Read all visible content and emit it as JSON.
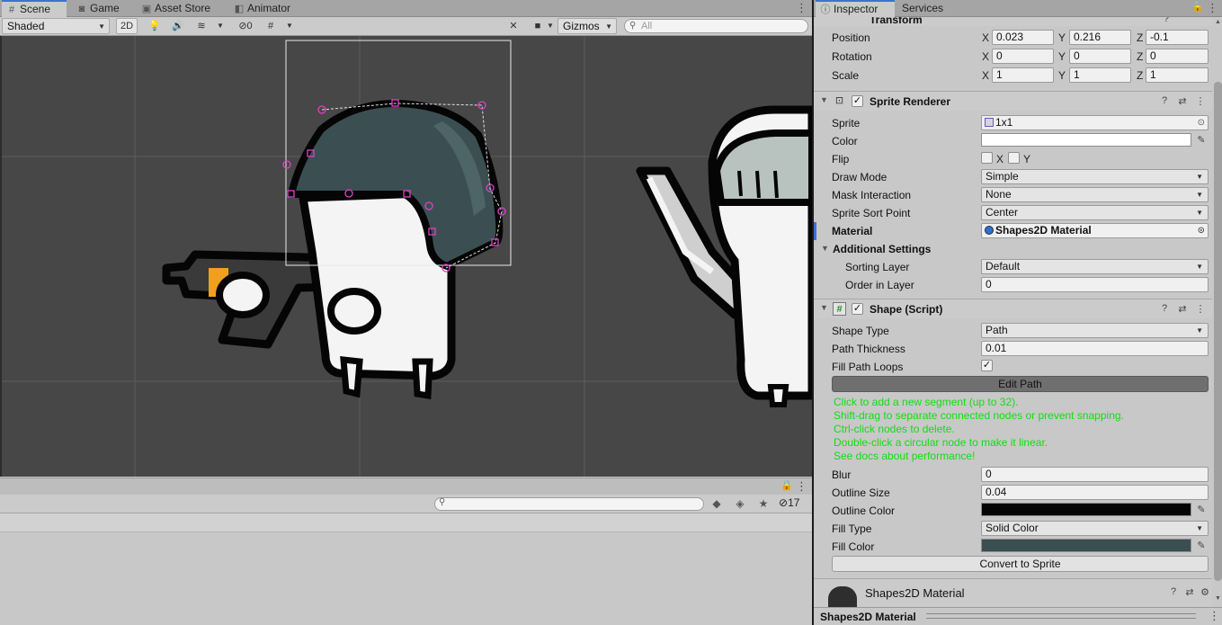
{
  "scene_window": {
    "tabs": [
      {
        "label": "Scene",
        "icon": "grid-icon"
      },
      {
        "label": "Game",
        "icon": "gamepad-icon"
      },
      {
        "label": "Asset Store",
        "icon": "store-icon"
      },
      {
        "label": "Animator",
        "icon": "animator-icon"
      }
    ],
    "toolbar": {
      "draw_mode": "Shaded",
      "mode_2d": "2D",
      "hidden_count": "0",
      "gizmos": "Gizmos",
      "search_placeholder": "All"
    }
  },
  "lower_panel": {
    "hidden_count": "17"
  },
  "inspector": {
    "tabs": [
      {
        "label": "Inspector",
        "icon": "info-icon"
      },
      {
        "label": "Services",
        "icon": ""
      }
    ],
    "transform": {
      "title": "Transform",
      "position": {
        "label": "Position",
        "x": "0.023",
        "y": "0.216",
        "z": "-0.1"
      },
      "rotation": {
        "label": "Rotation",
        "x": "0",
        "y": "0",
        "z": "0"
      },
      "scale": {
        "label": "Scale",
        "x": "1",
        "y": "1",
        "z": "1"
      },
      "axis_x": "X",
      "axis_y": "Y",
      "axis_z": "Z"
    },
    "sprite_renderer": {
      "title": "Sprite Renderer",
      "sprite": {
        "label": "Sprite",
        "value": "1x1"
      },
      "color": {
        "label": "Color",
        "value": "#ffffff"
      },
      "flip": {
        "label": "Flip",
        "x_label": "X",
        "y_label": "Y"
      },
      "draw_mode": {
        "label": "Draw Mode",
        "value": "Simple"
      },
      "mask_interaction": {
        "label": "Mask Interaction",
        "value": "None"
      },
      "sprite_sort_point": {
        "label": "Sprite Sort Point",
        "value": "Center"
      },
      "material": {
        "label": "Material",
        "value": "Shapes2D Material"
      },
      "additional_settings": "Additional Settings",
      "sorting_layer": {
        "label": "Sorting Layer",
        "value": "Default"
      },
      "order_in_layer": {
        "label": "Order in Layer",
        "value": "0"
      }
    },
    "shape_script": {
      "title": "Shape (Script)",
      "shape_type": {
        "label": "Shape Type",
        "value": "Path"
      },
      "path_thickness": {
        "label": "Path Thickness",
        "value": "0.01"
      },
      "fill_path_loops": {
        "label": "Fill Path Loops",
        "checked": true
      },
      "edit_path_button": "Edit Path",
      "help_lines": [
        "Click to add a new segment (up to 32).",
        "Shift-drag to separate connected nodes or prevent snapping.",
        "Ctrl-click nodes to delete.",
        "Double-click a circular node to make it linear.",
        "See docs about performance!"
      ],
      "blur": {
        "label": "Blur",
        "value": "0"
      },
      "outline_size": {
        "label": "Outline Size",
        "value": "0.04"
      },
      "outline_color": {
        "label": "Outline Color",
        "value": "#050505"
      },
      "fill_type": {
        "label": "Fill Type",
        "value": "Solid Color"
      },
      "fill_color": {
        "label": "Fill Color",
        "value": "#3b4f52"
      },
      "convert_button": "Convert to Sprite"
    },
    "material_preview": {
      "name": "Shapes2D Material"
    },
    "status_title": "Shapes2D Material"
  },
  "colors": {
    "accent": "#3a72d8",
    "viewport_bg": "#474747",
    "helmet": "#3b4f52",
    "help_text": "#12dd12",
    "path_handles": "#e040c8"
  }
}
